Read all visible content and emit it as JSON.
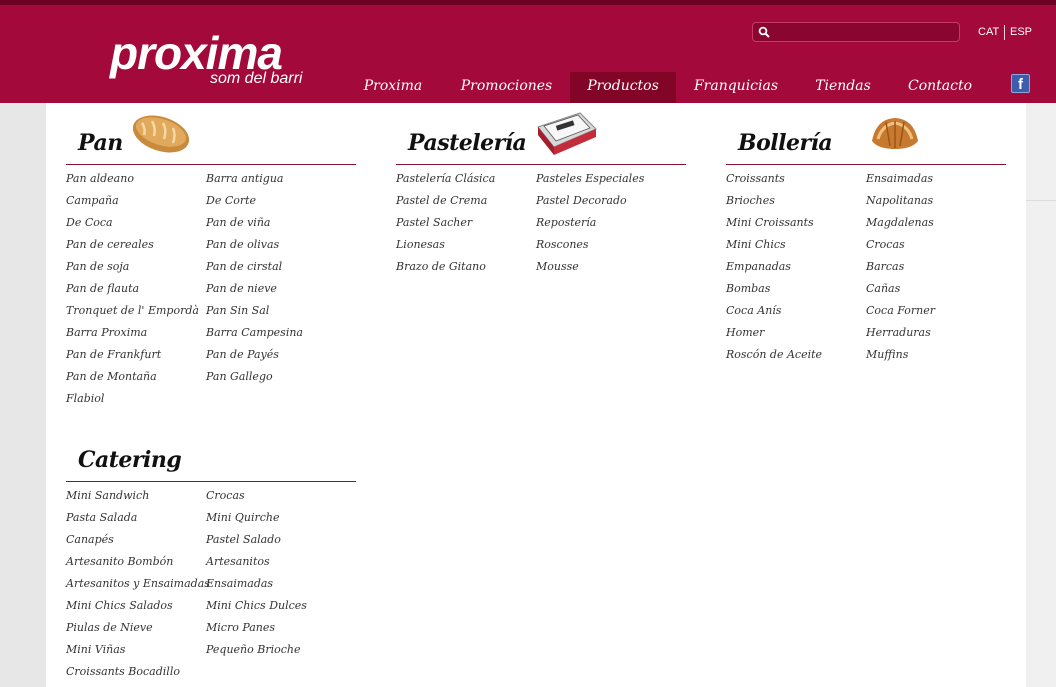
{
  "brand": {
    "name": "proxima",
    "tagline": "som del barri"
  },
  "search": {
    "placeholder": "",
    "value": ""
  },
  "languages": {
    "cat": "CAT",
    "esp": "ESP"
  },
  "nav": {
    "items": [
      "Proxima",
      "Promociones",
      "Productos",
      "Franquicias",
      "Tiendas",
      "Contacto"
    ],
    "active": "Productos"
  },
  "social": {
    "facebook_glyph": "f"
  },
  "sections": {
    "pan": {
      "title": "Pan",
      "icon": "bread-loaf-icon",
      "col1": [
        "Pan aldeano",
        "Campaña",
        "De Coca",
        "Pan de cereales",
        "Pan de soja",
        "Pan de flauta",
        "Tronquet de l' Empordà",
        "Barra Proxima",
        "Pan de Frankfurt",
        "Pan de Montaña",
        "Flabiol"
      ],
      "col2": [
        "Barra antigua",
        "De Corte",
        "Pan de viña",
        "Pan de olivas",
        "Pan de cirstal",
        "Pan de nieve",
        "Pan Sin Sal",
        "Barra Campesina",
        "Pan de Payés",
        "Pan Gallego"
      ]
    },
    "pasteleria": {
      "title": "Pastelería",
      "icon": "cake-box-icon",
      "col1": [
        "Pastelería Clásica",
        "Pastel de Crema",
        "Pastel Sacher",
        "Lionesas",
        "Brazo de Gitano"
      ],
      "col2": [
        "Pasteles Especiales",
        "Pastel Decorado",
        "Repostería",
        "Roscones",
        "Mousse"
      ]
    },
    "bolleria": {
      "title": "Bollería",
      "icon": "croissant-icon",
      "col1": [
        "Croissants",
        "Brioches",
        "Mini Croissants",
        "Mini Chics",
        "Empanadas",
        "Bombas",
        "Coca Anís",
        "Homer",
        "Roscón de Aceite"
      ],
      "col2": [
        "Ensaimadas",
        "Napolitanas",
        "Magdalenas",
        "Crocas",
        "Barcas",
        "Cañas",
        "Coca Forner",
        "Herraduras",
        "Muffins"
      ]
    },
    "catering": {
      "title": "Catering",
      "col1": [
        "Mini Sandwich",
        "Pasta Salada",
        "Canapés",
        "Artesanito Bombón",
        "Artesanitos y Ensaimadas",
        "Mini Chics Salados",
        "Piulas de Nieve",
        "Mini Viñas",
        "Croissants Bocadillo"
      ],
      "col2": [
        "Crocas",
        "Mini Quirche",
        "Pastel Salado",
        "Artesanitos",
        "Ensaimadas",
        "Mini Chics Dulces",
        "Micro Panes",
        "Pequeño Brioche"
      ]
    }
  },
  "colors": {
    "brand": "#a3093b",
    "brand_dark": "#820427",
    "rule": "#8c1030",
    "text": "#333333"
  }
}
